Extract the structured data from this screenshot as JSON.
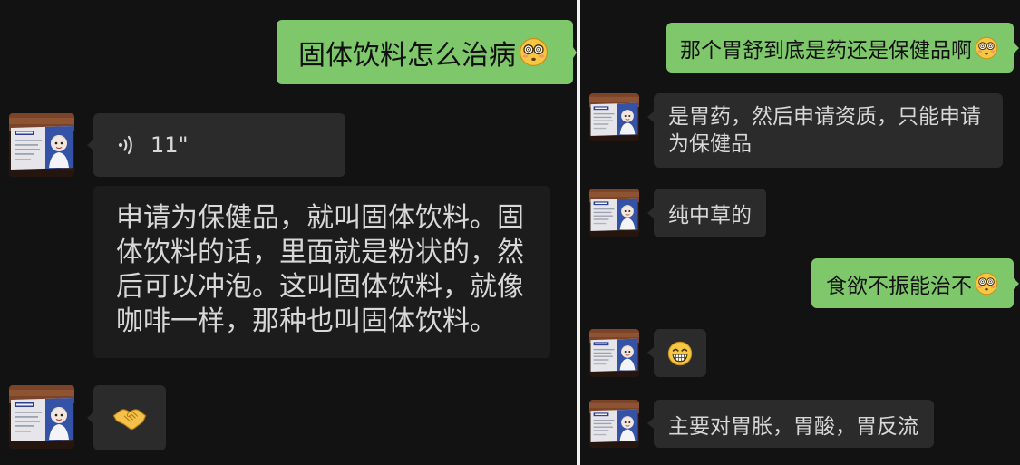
{
  "colors": {
    "background": "#121212",
    "divider": "#f2f2f2",
    "sent_bubble": "#7ec86b",
    "sent_text": "#111111",
    "received_bubble": "#2b2b2b",
    "received_text": "#d8d8d8",
    "transcript_bubble": "#1c1c1c"
  },
  "left_chat": {
    "sent_question": {
      "text": "固体饮料怎么治病",
      "emoji_icon": "flushed-face-icon"
    },
    "voice_message": {
      "icon": "voice-wave-icon",
      "duration": "11\""
    },
    "voice_transcript": {
      "lines": [
        "申请为保健品，就叫固体饮料。固",
        "体饮料的话，里面就是粉状的，然",
        "后可以冲泡。这叫固体饮料，就像",
        "咖啡一样，那种也叫固体饮料。"
      ]
    },
    "reply_emoji": {
      "emoji_icon": "handshake-icon"
    }
  },
  "right_chat": {
    "sent_question_1": {
      "text": "那个胃舒到底是药还是保健品啊",
      "emoji_icon": "flushed-face-icon"
    },
    "reply_1": {
      "lines": [
        "是胃药，然后申请资质，只能申请",
        "为保健品"
      ]
    },
    "reply_2": {
      "text": "纯中草的"
    },
    "sent_question_2": {
      "text": "食欲不振能治不",
      "emoji_icon": "flushed-face-icon"
    },
    "reply_3": {
      "emoji_icon": "grinning-face-icon"
    },
    "reply_4": {
      "text": "主要对胃胀，胃酸，胃反流"
    }
  }
}
